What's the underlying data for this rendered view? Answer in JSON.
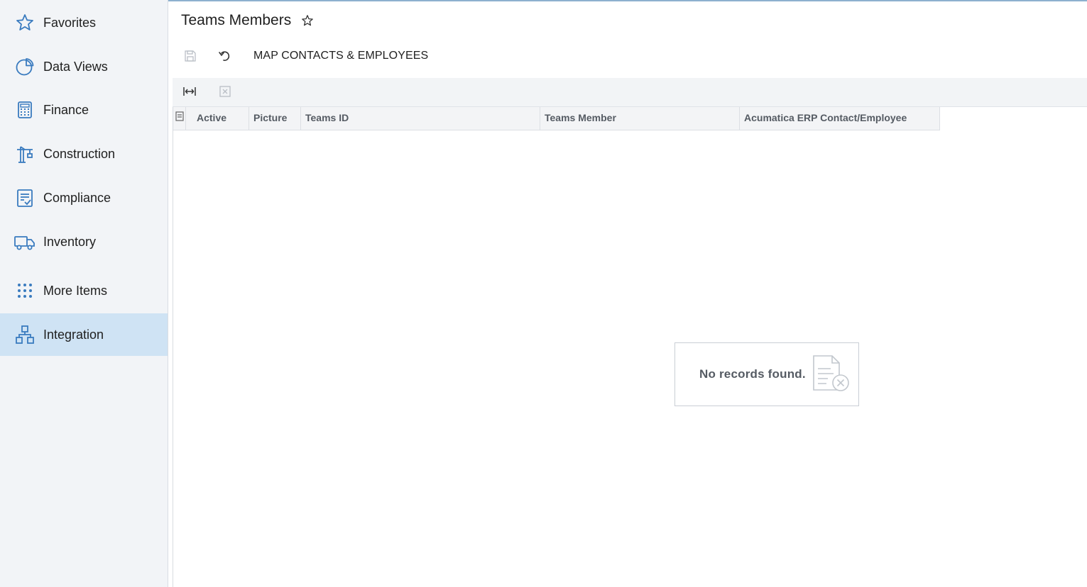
{
  "sidebar": {
    "items": [
      {
        "label": "Favorites",
        "icon": "star-icon"
      },
      {
        "label": "Data Views",
        "icon": "pie-chart-icon"
      },
      {
        "label": "Finance",
        "icon": "calculator-icon"
      },
      {
        "label": "Construction",
        "icon": "crane-icon"
      },
      {
        "label": "Compliance",
        "icon": "checklist-icon"
      },
      {
        "label": "Inventory",
        "icon": "truck-icon"
      },
      {
        "label": "More Items",
        "icon": "grid-dots-icon"
      },
      {
        "label": "Integration",
        "icon": "hierarchy-icon"
      }
    ],
    "active_item": "Integration"
  },
  "header": {
    "title": "Teams Members",
    "favorite_icon": "star-outline-icon"
  },
  "toolbar": {
    "save_icon": "save-icon",
    "undo_icon": "undo-icon",
    "action_label": "MAP CONTACTS & EMPLOYEES"
  },
  "grid_toolbar": {
    "fit_icon": "fit-columns-icon",
    "export_icon": "export-excel-icon"
  },
  "grid": {
    "columns": [
      "Active",
      "Picture",
      "Teams ID",
      "Teams Member",
      "Acumatica ERP Contact/Employee"
    ],
    "rows": [],
    "empty_message": "No records found."
  },
  "colors": {
    "accent": "#2f6fa8",
    "sidebar_bg": "#f2f4f7",
    "active_bg": "#cfe3f4",
    "icon_blue": "#3a7bbf"
  }
}
